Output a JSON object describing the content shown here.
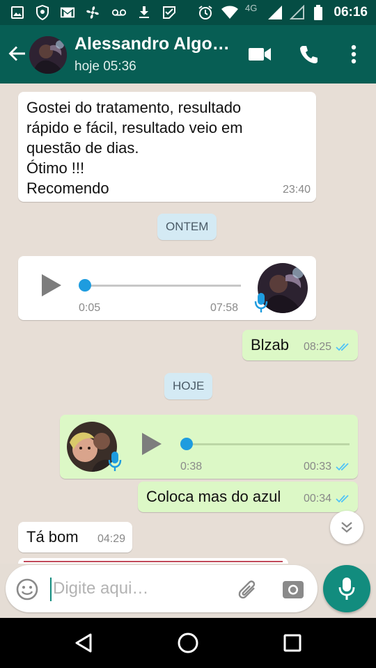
{
  "status_bar": {
    "time": "06:16",
    "network": "4G",
    "icons": [
      "image-icon",
      "shield-icon",
      "gmail-icon",
      "fan-icon",
      "voicemail-icon",
      "download-icon",
      "check-square-icon",
      "alarm-icon",
      "wifi-icon",
      "signal-icon",
      "signal-empty-icon",
      "battery-icon"
    ]
  },
  "header": {
    "contact_name": "Alessandro Algo…",
    "last_seen": "hoje 05:36",
    "icons": [
      "back-arrow-icon",
      "video-call-icon",
      "phone-icon",
      "more-vert-icon"
    ]
  },
  "messages": [
    {
      "type": "text",
      "direction": "in",
      "lines": [
        "Gostei do tratamento, resultado",
        "rápido e fácil, resultado veio em",
        "questão de dias.",
        "Ótimo !!!",
        "Recomendo"
      ],
      "time": "23:40"
    },
    {
      "type": "date",
      "label": "ONTEM"
    },
    {
      "type": "voice",
      "direction": "in",
      "position": "0:05",
      "duration": "07:58",
      "progress": 0.0
    },
    {
      "type": "text",
      "direction": "out",
      "text": "Blzab",
      "time": "08:25",
      "status": "read"
    },
    {
      "type": "date",
      "label": "HOJE"
    },
    {
      "type": "voice",
      "direction": "out",
      "position": "0:38",
      "time": "00:33",
      "progress": 0.0,
      "status": "read"
    },
    {
      "type": "text",
      "direction": "out",
      "text": "Coloca mas do azul",
      "time": "00:34",
      "status": "read"
    },
    {
      "type": "text",
      "direction": "in",
      "text": "Tá bom",
      "time": "04:29"
    }
  ],
  "composer": {
    "placeholder": "Digite aqui…",
    "value": ""
  },
  "colors": {
    "header": "#075e54",
    "status_bar": "#054d44",
    "outgoing_bubble": "#dcf8c6",
    "incoming_bubble": "#ffffff",
    "date_chip": "#d4eaf4",
    "accent": "#128c7e",
    "read_ticks": "#4fc3f7",
    "voice_dot": "#1e9cdf"
  },
  "nav_bar": {
    "icons": [
      "back-triangle-icon",
      "home-circle-icon",
      "recents-square-icon"
    ]
  }
}
